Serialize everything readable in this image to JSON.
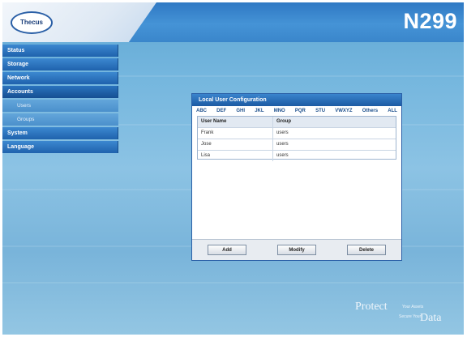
{
  "header": {
    "logo_text": "Thecus",
    "model": "N299"
  },
  "menu": {
    "status": "Status",
    "storage": "Storage",
    "network": "Network",
    "accounts": "Accounts",
    "users": "Users",
    "groups": "Groups",
    "system": "System",
    "language": "Language"
  },
  "panel": {
    "title": "Local User Configuration",
    "filters": [
      "ABC",
      "DEF",
      "GHI",
      "JKL",
      "MNO",
      "PQR",
      "STU",
      "VWXYZ",
      "Others",
      "ALL"
    ],
    "columns": {
      "name": "User Name",
      "group": "Group"
    },
    "rows": [
      {
        "name": "Frank",
        "group": "users"
      },
      {
        "name": "Jose",
        "group": "users"
      },
      {
        "name": "Lisa",
        "group": "users"
      }
    ],
    "buttons": {
      "add": "Add",
      "modify": "Modify",
      "delete": "Delete"
    }
  },
  "slogan": {
    "protect": "Protect",
    "your_assets": "Your Assets",
    "secure_your": "Secure Your",
    "data": "Data"
  }
}
